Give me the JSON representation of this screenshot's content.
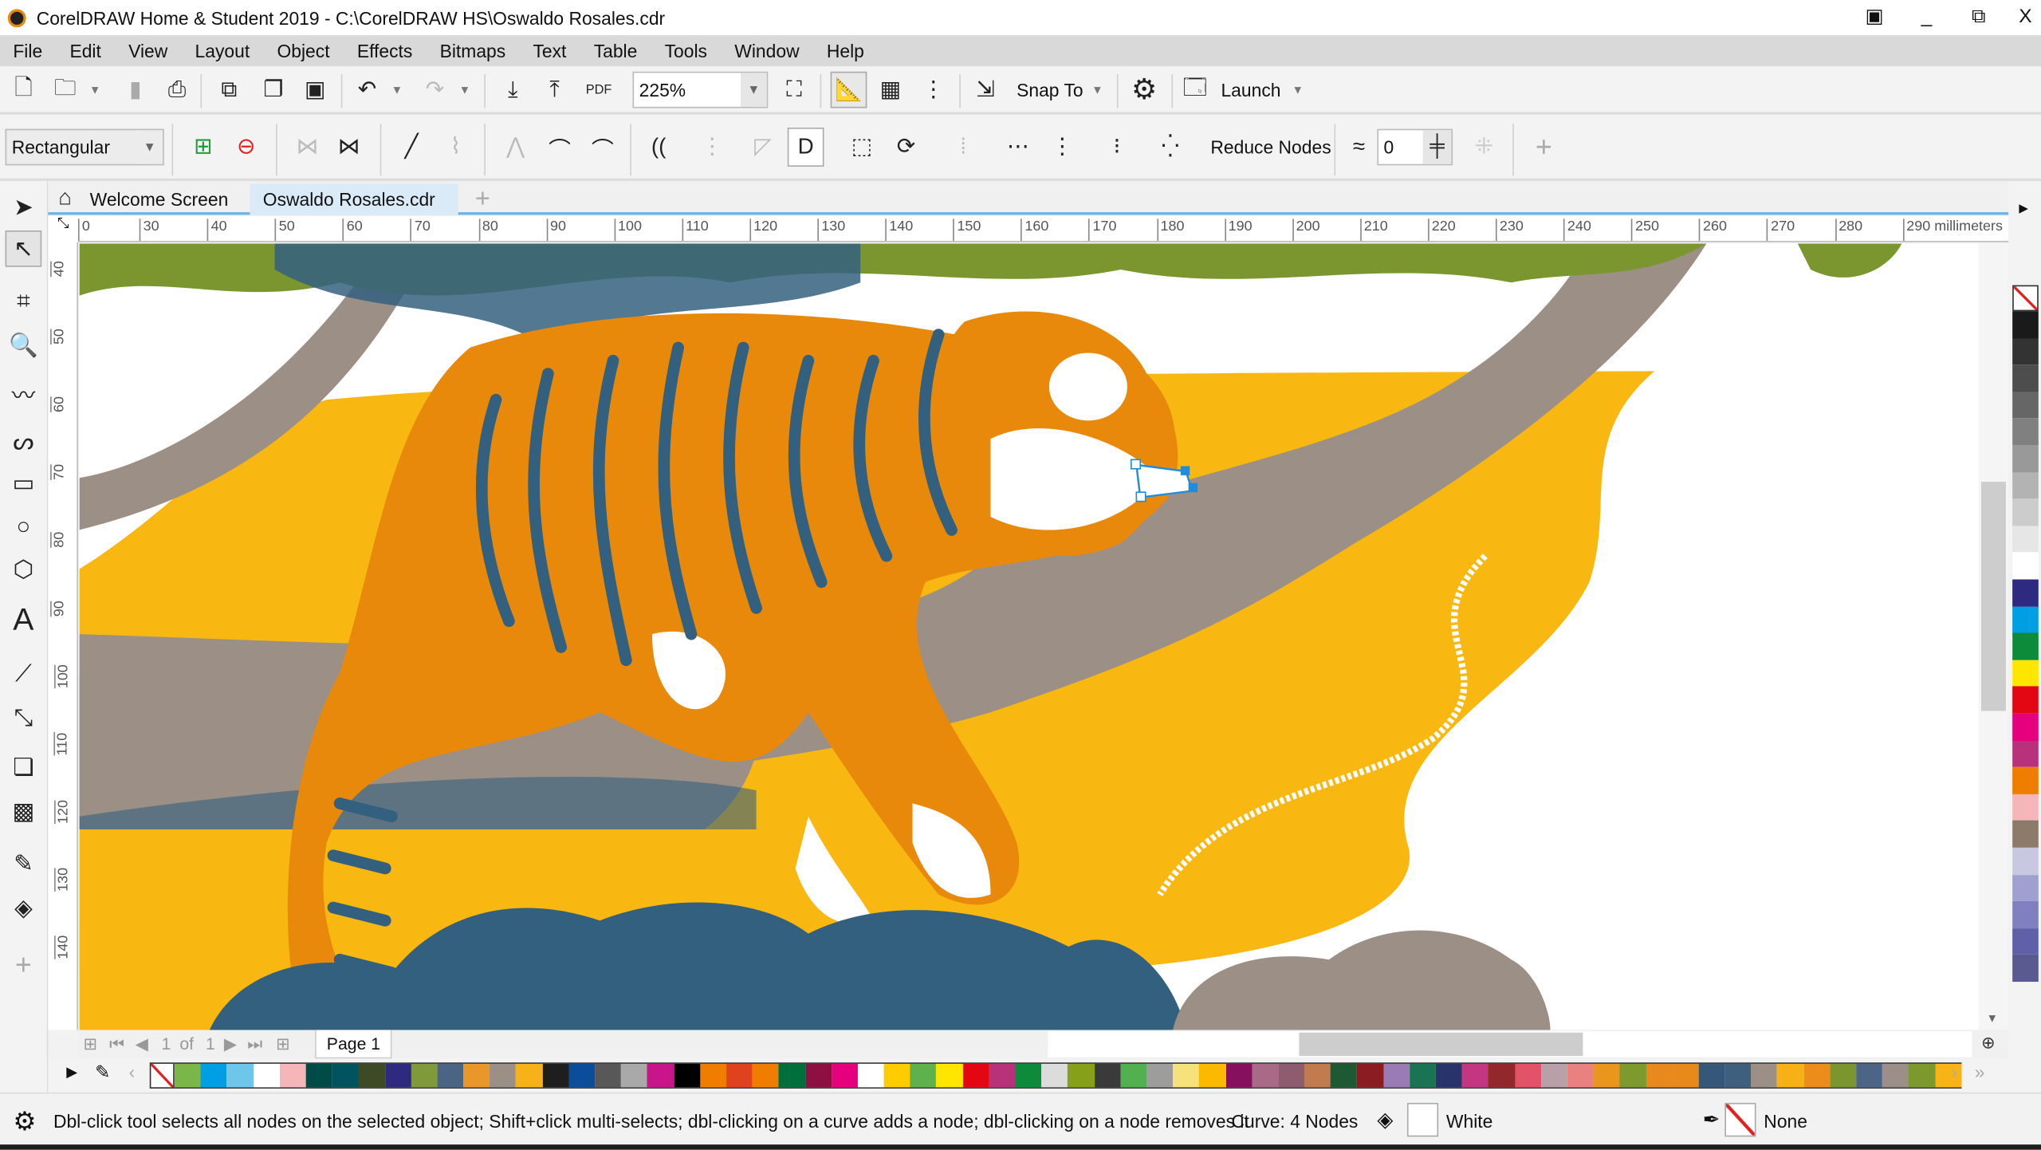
{
  "window": {
    "title": "CorelDRAW Home & Student 2019 - C:\\CorelDRAW HS\\Oswaldo Rosales.cdr",
    "minimize": "_",
    "restore": "⧉",
    "close": "X"
  },
  "menu": [
    "File",
    "Edit",
    "View",
    "Layout",
    "Object",
    "Effects",
    "Bitmaps",
    "Text",
    "Table",
    "Tools",
    "Window",
    "Help"
  ],
  "toolbar": {
    "zoom_value": "225%",
    "snap_to": "Snap To",
    "launch": "Launch",
    "pdf": "PDF"
  },
  "property_bar": {
    "selection_mode": "Rectangular",
    "reduce_nodes": "Reduce Nodes",
    "smoothness_value": "0"
  },
  "tabs": {
    "welcome": "Welcome Screen",
    "document": "Oswaldo Rosales.cdr",
    "add": "+"
  },
  "ruler": {
    "h_ticks": [
      "0",
      "30",
      "40",
      "50",
      "60",
      "70",
      "80",
      "90",
      "100",
      "110",
      "120",
      "130",
      "140",
      "150",
      "160",
      "170",
      "180",
      "190",
      "200",
      "210",
      "220",
      "230",
      "240",
      "250",
      "260",
      "270",
      "280",
      "290"
    ],
    "units": "millimeters",
    "v_ticks": [
      "40",
      "50",
      "60",
      "70",
      "80",
      "90",
      "100",
      "110",
      "120",
      "130",
      "140"
    ]
  },
  "pagebar": {
    "current": "1",
    "of": "of",
    "total": "1",
    "page_tab": "Page 1"
  },
  "palette": {
    "colors": [
      "#7ab648",
      "#009fe3",
      "#6ec6ea",
      "#ffffff",
      "#f4b6b8",
      "#004b48",
      "#00535f",
      "#3c4a26",
      "#2e2a7f",
      "#7e9a3a",
      "#4a6483",
      "#e9962b",
      "#9b8f86",
      "#f7b21a",
      "#1e1e1e",
      "#0b4d9a",
      "#585858",
      "#a9a9a9",
      "#c8158a",
      "#000000",
      "#ef7d00",
      "#e0411f",
      "#ef7d00",
      "#006f3c",
      "#8d1042",
      "#e6007e",
      "#ffffff",
      "#ffcc00",
      "#5fb14d",
      "#ffe600",
      "#e30613",
      "#b7327b",
      "#0e8a3b",
      "#dcdcdc",
      "#86a019",
      "#3a3a3a",
      "#52b050",
      "#9d9d9c",
      "#f6e27b",
      "#fbba00",
      "#86105e",
      "#a86a87",
      "#8e5b6f",
      "#c27a4f",
      "#1d5a33",
      "#8a1c22",
      "#9b7bb5",
      "#1a7454",
      "#27336a",
      "#c43681",
      "#92282b",
      "#e25368",
      "#b9a0a8",
      "#e8817f",
      "#e8961d",
      "#7e9a2f",
      "#e7891c",
      "#e8891c",
      "#34577a",
      "#3f5f7e",
      "#9c8f85",
      "#f7b117",
      "#eb8c1b",
      "#7c962f",
      "#4c6486",
      "#9b8f87",
      "#7d982d",
      "#f8b416"
    ],
    "side_colors": [
      "#1a1a1a",
      "#333333",
      "#4d4d4d",
      "#666666",
      "#808080",
      "#999999",
      "#b3b3b3",
      "#cccccc",
      "#e6e6e6",
      "#ffffff",
      "#2e2a7f",
      "#009fe3",
      "#0e8a3b",
      "#ffe600",
      "#e30613",
      "#e6007e",
      "#b7327b",
      "#ef7d00",
      "#f4b6b8",
      "#8c7b6b",
      "#c8c8e0",
      "#a0a0d0",
      "#8080c0",
      "#6060a8",
      "#5a5a90"
    ]
  },
  "status": {
    "hint": "Dbl-click tool selects all nodes on the selected object; Shift+click multi-selects; dbl-clicking on a curve adds a node; dbl-clicking on a node removes it",
    "object_info": "Curve: 4 Nodes",
    "fill": "White",
    "outline": "None"
  },
  "colors": {
    "accent": "#69b3e7",
    "tiger_orange": "#e8890c",
    "yellow": "#f9b712",
    "branch_gray": "#9b8f86",
    "leaf_green": "#7c962f",
    "bush_blue": "#34607f"
  }
}
